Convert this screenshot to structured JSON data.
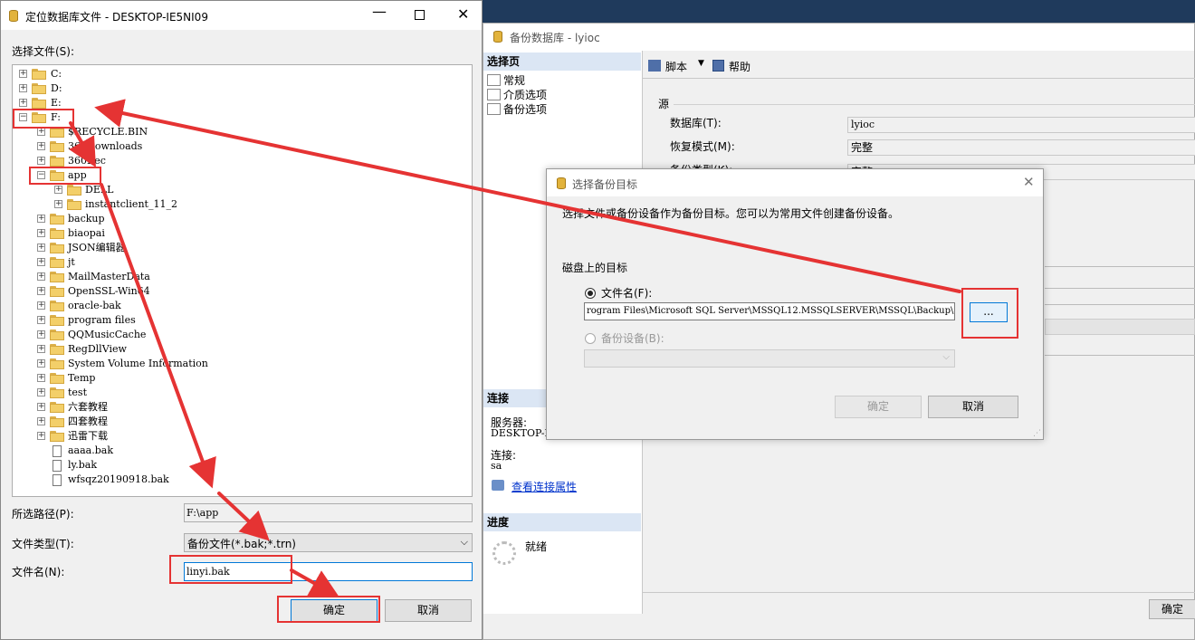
{
  "backup_window": {
    "title": "备份数据库 - lyioc",
    "nav": {
      "select_page_header": "选择页",
      "items": [
        "常规",
        "介质选项",
        "备份选项"
      ],
      "connection_header": "连接",
      "server_label": "服务器:",
      "server_value": "DESKTOP-IE",
      "connection_label": "连接:",
      "connection_value": "sa",
      "view_props_link": "查看连接属性",
      "progress_header": "进度",
      "progress_status": "就绪"
    },
    "toolbar": {
      "script_label": "脚本",
      "help_label": "帮助"
    },
    "source": {
      "group_label": "源",
      "database_label": "数据库(T):",
      "database_value": "lyioc",
      "recovery_label": "恢复模式(M):",
      "recovery_value": "完整",
      "backup_type_label": "备份类型(K):",
      "backup_type_value": "完整"
    },
    "ok_label": "确定"
  },
  "target_dialog": {
    "title": "选择备份目标",
    "description": "选择文件或备份设备作为备份目标。您可以为常用文件创建备份设备。",
    "disk_group": "磁盘上的目标",
    "filename_radio": "文件名(F):",
    "filename_value": "rogram Files\\Microsoft SQL Server\\MSSQL12.MSSQLSERVER\\MSSQL\\Backup\\",
    "browse_label": "...",
    "device_radio": "备份设备(B):",
    "ok_label": "确定",
    "cancel_label": "取消"
  },
  "locate_dialog": {
    "title": "定位数据库文件 - DESKTOP-IE5NI09",
    "select_file_label": "选择文件(S):",
    "tree": {
      "drives": [
        "C:",
        "D:",
        "E:",
        "F:"
      ],
      "f_children": [
        "$RECYCLE.BIN",
        "360Downloads",
        "360Rec",
        "app"
      ],
      "app_children": [
        "DELL",
        "instantclient_11_2"
      ],
      "f_more": [
        "backup",
        "biaopai",
        "JSON编辑器",
        "jt",
        "MailMasterData",
        "OpenSSL-Win64",
        "oracle-bak",
        "program files",
        "QQMusicCache",
        "RegDllView",
        "System Volume Information",
        "Temp",
        "test",
        "六套教程",
        "四套教程",
        "迅雷下载"
      ],
      "files": [
        "aaaa.bak",
        "ly.bak",
        "wfsqz20190918.bak"
      ]
    },
    "path_label": "所选路径(P):",
    "path_value": "F:\\app",
    "type_label": "文件类型(T):",
    "type_value": "备份文件(*.bak;*.trn)",
    "filename_label": "文件名(N):",
    "filename_value": "linyi.bak",
    "ok_label": "确定",
    "cancel_label": "取消"
  },
  "colors": {
    "annotation": "#e53333",
    "nav_header": "#dbe6f4",
    "link": "#0033cc"
  }
}
